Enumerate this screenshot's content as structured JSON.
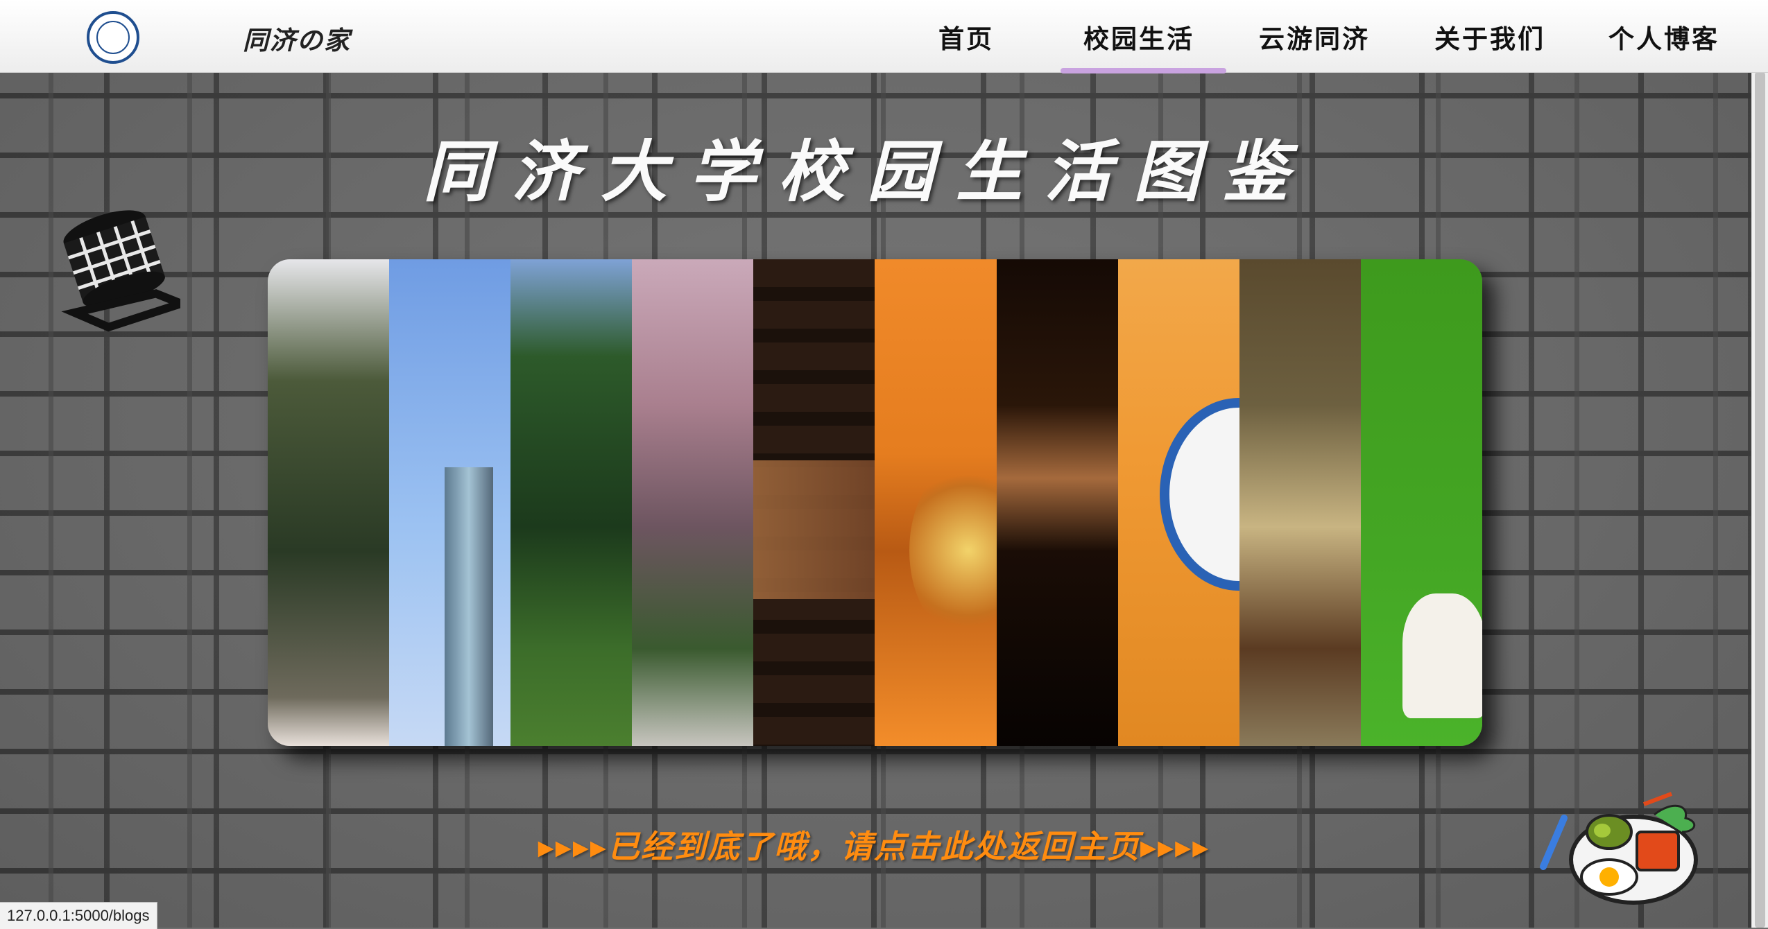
{
  "navbar": {
    "brand": "同济の家",
    "items": [
      {
        "label": "首页"
      },
      {
        "label": "校园生活"
      },
      {
        "label": "云游同济"
      },
      {
        "label": "关于我们"
      },
      {
        "label": "个人博客"
      }
    ],
    "active_index": 1,
    "active_color": "#c9a3e0"
  },
  "main": {
    "title": "同济大学校园生活图鉴",
    "gallery": {
      "panel_count": 10
    },
    "back_link": "▸▸▸▸已经到底了哦，请点击此处返回主页▸▸▸▸",
    "back_link_color": "#ff8c10"
  },
  "status_bar": {
    "url": "127.0.0.1:5000/blogs"
  },
  "icons": [
    "tongji-logo-icon",
    "lantern-icon",
    "food-plate-icon"
  ]
}
